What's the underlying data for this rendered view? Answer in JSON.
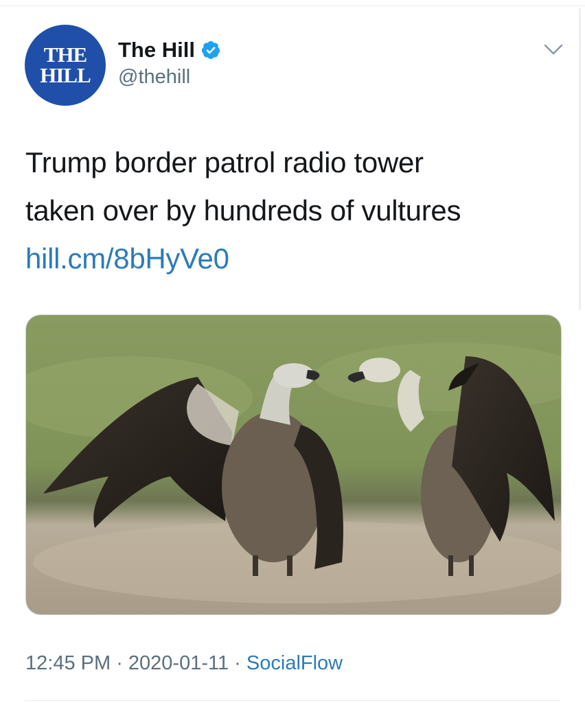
{
  "account": {
    "avatar_line1": "THE",
    "avatar_line2": "HILL",
    "display_name": "The Hill",
    "handle": "@thehill",
    "verified": true
  },
  "tweet": {
    "line1": "Trump border patrol radio tower",
    "line2": "taken over by hundreds of vultures",
    "link": "hill.cm/8bHyVe0"
  },
  "media": {
    "alt": "Two vultures with wings spread facing each other"
  },
  "meta": {
    "time": "12:45 PM",
    "separator": " · ",
    "date": "2020-01-11",
    "source": "SocialFlow"
  },
  "icons": {
    "verified": "verified-badge-icon",
    "menu": "chevron-down-icon"
  },
  "colors": {
    "avatar_bg": "#1f4fa8",
    "link": "#2b7bb9",
    "verified": "#1da1f2",
    "secondary_text": "#5b6f7d"
  }
}
